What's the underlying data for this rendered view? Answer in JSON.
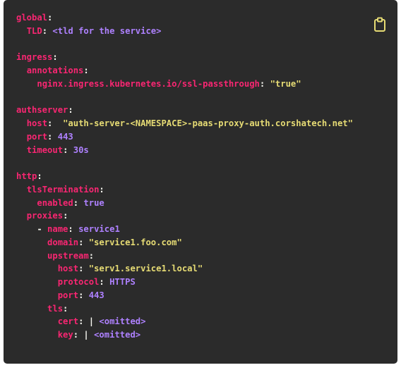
{
  "code": {
    "lines": [
      {
        "indent": "",
        "key": "global",
        "sep": ":",
        "value": "",
        "vtype": ""
      },
      {
        "indent": "  ",
        "key": "TLD",
        "sep": ": ",
        "value": "<tld for the service>",
        "vtype": "plain"
      },
      {
        "indent": "",
        "key": "",
        "sep": "",
        "value": "",
        "vtype": ""
      },
      {
        "indent": "",
        "key": "ingress",
        "sep": ":",
        "value": "",
        "vtype": ""
      },
      {
        "indent": "  ",
        "key": "annotations",
        "sep": ":",
        "value": "",
        "vtype": ""
      },
      {
        "indent": "    ",
        "key": "nginx.ingress.kubernetes.io/ssl-passthrough",
        "sep": ": ",
        "value": "\"true\"",
        "vtype": "str"
      },
      {
        "indent": "",
        "key": "",
        "sep": "",
        "value": "",
        "vtype": ""
      },
      {
        "indent": "",
        "key": "authserver",
        "sep": ":",
        "value": "",
        "vtype": ""
      },
      {
        "indent": "  ",
        "key": "host",
        "sep": ":  ",
        "value": "\"auth-server-<NAMESPACE>-paas-proxy-auth.corshatech.net\"",
        "vtype": "str"
      },
      {
        "indent": "  ",
        "key": "port",
        "sep": ": ",
        "value": "443",
        "vtype": "num"
      },
      {
        "indent": "  ",
        "key": "timeout",
        "sep": ": ",
        "value": "30s",
        "vtype": "plain"
      },
      {
        "indent": "",
        "key": "",
        "sep": "",
        "value": "",
        "vtype": ""
      },
      {
        "indent": "",
        "key": "http",
        "sep": ":",
        "value": "",
        "vtype": ""
      },
      {
        "indent": "  ",
        "key": "tlsTermination",
        "sep": ":",
        "value": "",
        "vtype": ""
      },
      {
        "indent": "    ",
        "key": "enabled",
        "sep": ": ",
        "value": "true",
        "vtype": "num"
      },
      {
        "indent": "  ",
        "key": "proxies",
        "sep": ":",
        "value": "",
        "vtype": ""
      },
      {
        "indent": "    - ",
        "key": "name",
        "sep": ": ",
        "value": "service1",
        "vtype": "plain"
      },
      {
        "indent": "      ",
        "key": "domain",
        "sep": ": ",
        "value": "\"service1.foo.com\"",
        "vtype": "str"
      },
      {
        "indent": "      ",
        "key": "upstream",
        "sep": ":",
        "value": "",
        "vtype": ""
      },
      {
        "indent": "        ",
        "key": "host",
        "sep": ": ",
        "value": "\"serv1.service1.local\"",
        "vtype": "str"
      },
      {
        "indent": "        ",
        "key": "protocol",
        "sep": ": ",
        "value": "HTTPS",
        "vtype": "plain"
      },
      {
        "indent": "        ",
        "key": "port",
        "sep": ": ",
        "value": "443",
        "vtype": "num"
      },
      {
        "indent": "      ",
        "key": "tls",
        "sep": ":",
        "value": "",
        "vtype": ""
      },
      {
        "indent": "        ",
        "key": "cert",
        "sep": ": | ",
        "value": "<omitted>",
        "vtype": "plain"
      },
      {
        "indent": "        ",
        "key": "key",
        "sep": ": | ",
        "value": "<omitted>",
        "vtype": "plain"
      }
    ]
  },
  "copy_button": {
    "icon": "clipboard-icon"
  },
  "colors": {
    "background": "#2b2b2b",
    "key": "#f92672",
    "string": "#e6db74",
    "value": "#ae81ff",
    "icon": "#e6db74"
  }
}
